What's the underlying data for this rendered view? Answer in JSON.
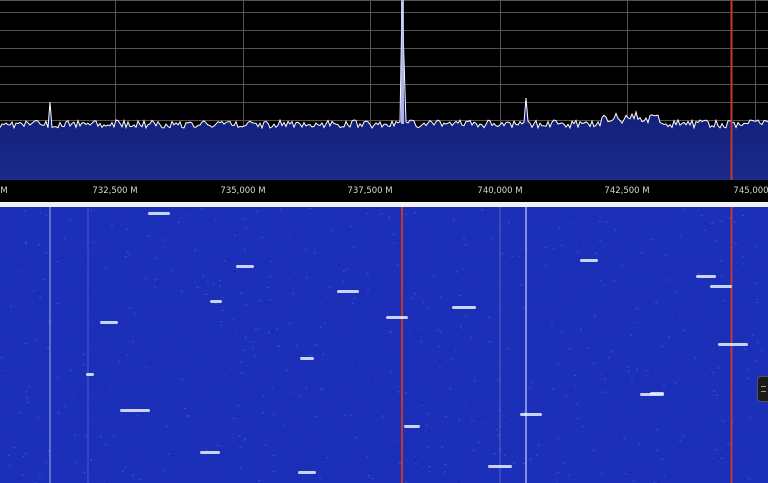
{
  "frequency_axis": {
    "unit_suffix": "M",
    "labels": [
      {
        "id": "left-edge",
        "text": "M"
      },
      {
        "id": "732500",
        "text": "732,500 M"
      },
      {
        "id": "735000",
        "text": "735,000 M"
      },
      {
        "id": "737500",
        "text": "737,500 M"
      },
      {
        "id": "740000",
        "text": "740,000 M"
      },
      {
        "id": "742500",
        "text": "742,500 M"
      },
      {
        "id": "745000",
        "text": "745,000"
      }
    ]
  },
  "colors": {
    "spectrum_fill_top": "#0a1060",
    "spectrum_fill_bottom": "#1a2a8a",
    "spectrum_trace": "#ffffff",
    "grid": "#555555",
    "marker": "#c0392b",
    "waterfall_base": "#1c2fb8",
    "waterfall_signal": "#e8f0ff"
  },
  "markers": {
    "red_marker_count": 2
  },
  "icons": {
    "waterfall_handle": "drag-handle-icon"
  }
}
